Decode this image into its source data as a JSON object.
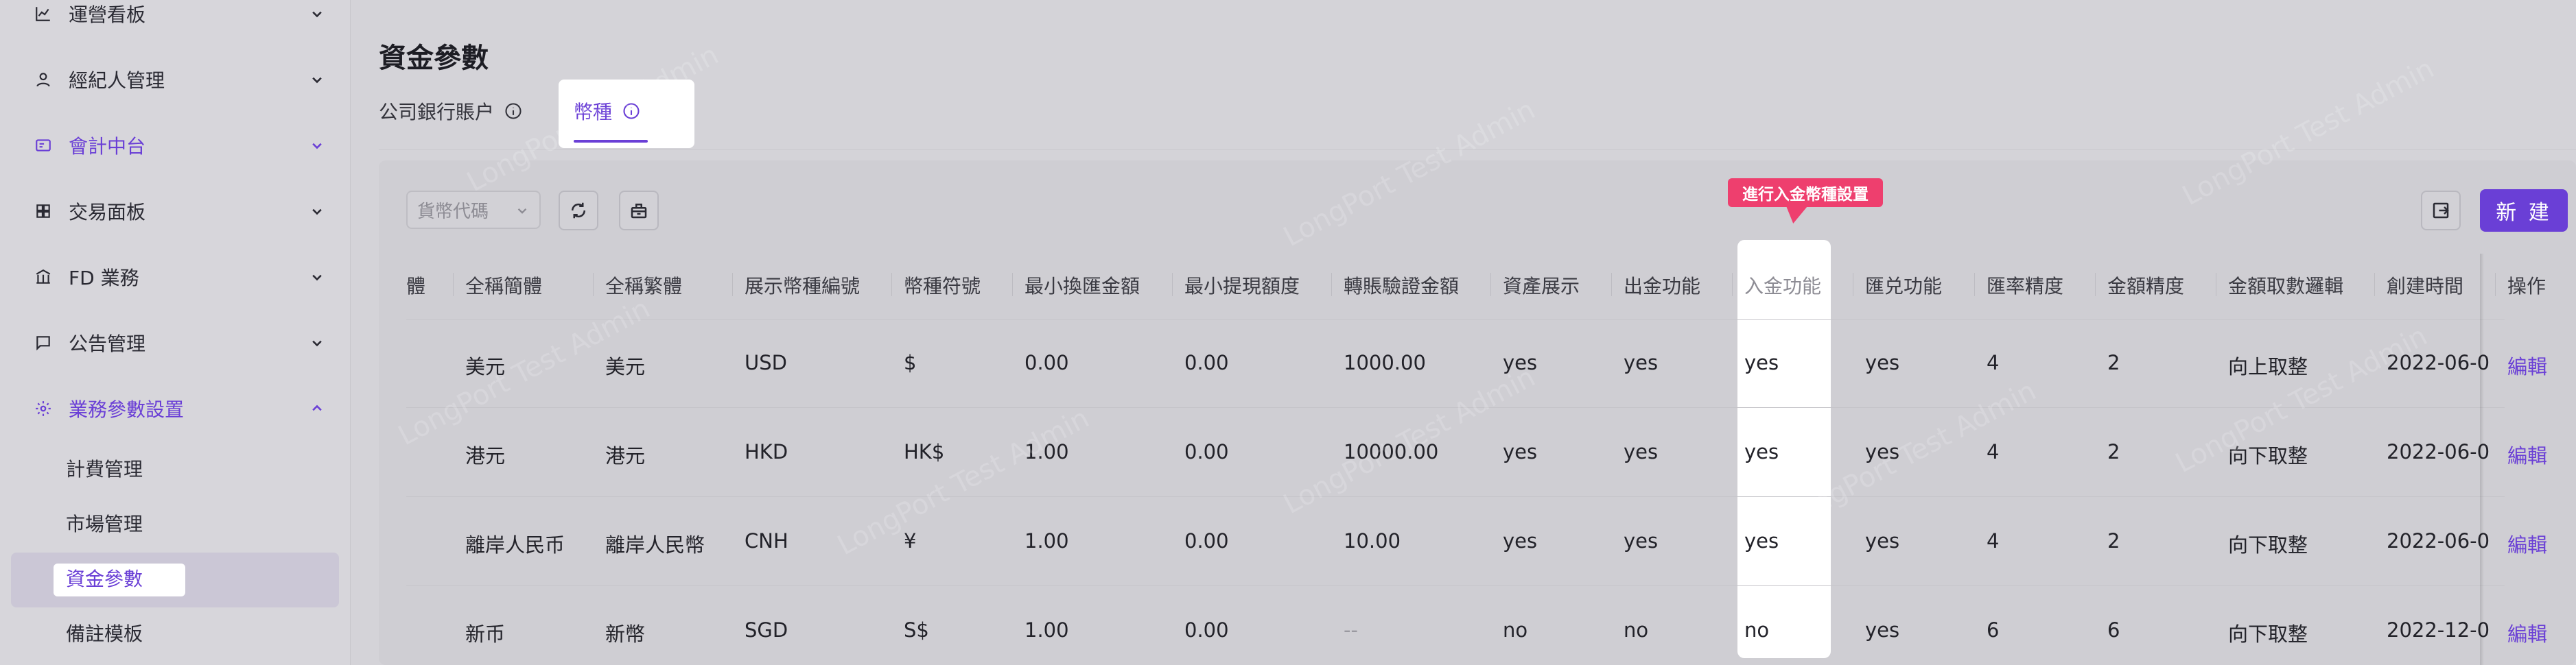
{
  "sidebar": {
    "items": [
      {
        "label": "運營看板",
        "icon": "chart-line-icon",
        "expanded": false
      },
      {
        "label": "經紀人管理",
        "icon": "user-icon",
        "expanded": false
      },
      {
        "label": "會計中台",
        "icon": "ledger-icon",
        "expanded": false
      },
      {
        "label": "交易面板",
        "icon": "grid-icon",
        "expanded": false
      },
      {
        "label": "FD 業務",
        "icon": "bank-icon",
        "expanded": false
      },
      {
        "label": "公告管理",
        "icon": "message-icon",
        "expanded": false
      },
      {
        "label": "業務參數設置",
        "icon": "gear-icon",
        "expanded": true
      }
    ],
    "sub_items": [
      {
        "label": "計費管理"
      },
      {
        "label": "市場管理"
      },
      {
        "label": "資金參數",
        "active": true
      },
      {
        "label": "備註模板"
      }
    ]
  },
  "header": {
    "title": "資金參數",
    "tabs": [
      {
        "label": "公司銀行賬户",
        "active": false
      },
      {
        "label": "幣種",
        "active": true
      }
    ]
  },
  "toolbar": {
    "currency_select_placeholder": "貨幣代碼",
    "new_label": "新 建"
  },
  "tooltip": {
    "text": "進行入金幣種設置"
  },
  "watermark": "LongPort Test Admin",
  "table": {
    "columns": [
      "體",
      "全稱簡體",
      "全稱繁體",
      "展示幣種編號",
      "幣種符號",
      "最小換匯金額",
      "最小提現額度",
      "轉賬驗證金額",
      "資產展示",
      "出金功能",
      "入金功能",
      "匯兑功能",
      "匯率精度",
      "金額精度",
      "金額取數邏輯",
      "創建時間",
      "操作"
    ],
    "rows": [
      [
        "美元",
        "美元",
        "USD",
        "$",
        "0.00",
        "0.00",
        "1000.00",
        "yes",
        "yes",
        "yes",
        "yes",
        "4",
        "2",
        "向上取整",
        "2022-06-0",
        "編輯"
      ],
      [
        "港元",
        "港元",
        "HKD",
        "HK$",
        "1.00",
        "0.00",
        "10000.00",
        "yes",
        "yes",
        "yes",
        "yes",
        "4",
        "2",
        "向下取整",
        "2022-06-0",
        "編輯"
      ],
      [
        "離岸人民币",
        "離岸人民幣",
        "CNH",
        "¥",
        "1.00",
        "0.00",
        "10.00",
        "yes",
        "yes",
        "yes",
        "yes",
        "4",
        "2",
        "向下取整",
        "2022-06-0",
        "編輯"
      ],
      [
        "新币",
        "新幣",
        "SGD",
        "S$",
        "1.00",
        "0.00",
        "--",
        "no",
        "no",
        "no",
        "yes",
        "6",
        "6",
        "向下取整",
        "2022-12-0",
        "編輯"
      ]
    ]
  },
  "colors": {
    "accent": "#6a3fd6",
    "tooltip": "#ee3f6e"
  }
}
